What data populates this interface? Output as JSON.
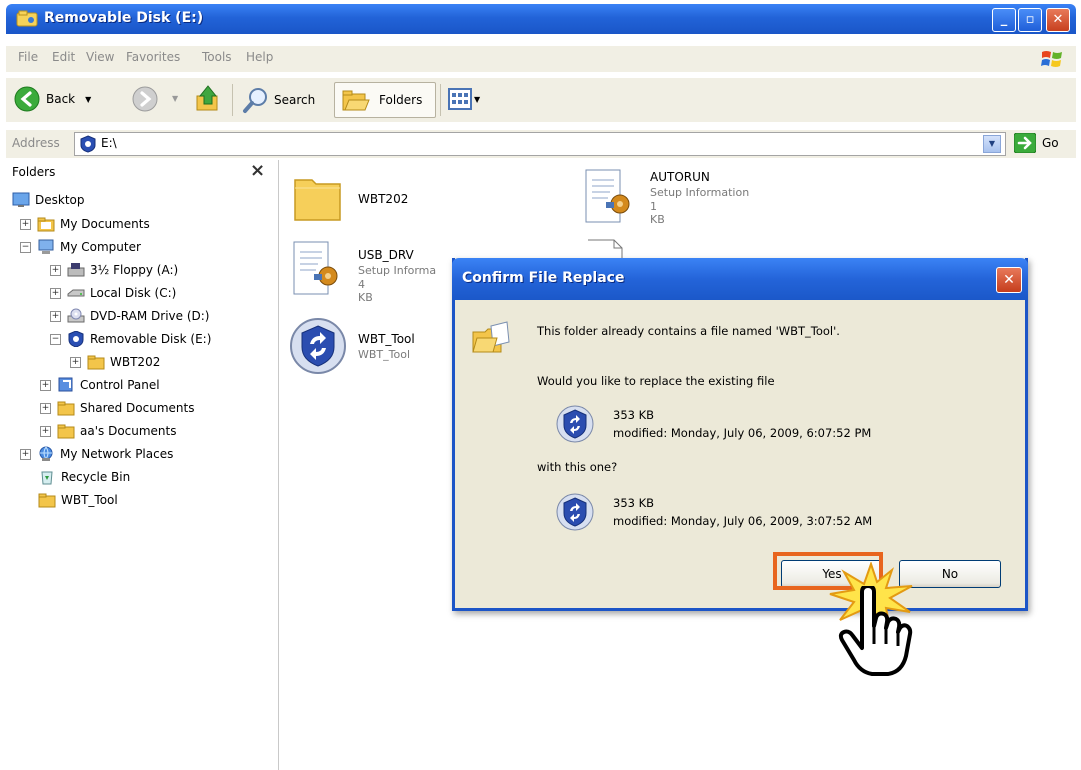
{
  "window": {
    "title": "Removable Disk (E:)",
    "buttons": [
      "minimize",
      "maximize",
      "close"
    ],
    "minimize_glyph": "_",
    "maximize_glyph": "▫",
    "close_glyph": "✕"
  },
  "menu": {
    "file": "File",
    "edit": "Edit",
    "view": "View",
    "favorites": "Favorites",
    "tools": "Tools",
    "help": "Help"
  },
  "toolbar": {
    "back": "Back",
    "search": "Search",
    "folders": "Folders"
  },
  "address": {
    "label": "Address",
    "value": "E:\\",
    "go": "Go"
  },
  "folder_pane": {
    "header": "Folders",
    "close_glyph": "×",
    "tree": [
      {
        "label": "Desktop",
        "expander": ""
      },
      {
        "label": "My Documents",
        "expander": "+"
      },
      {
        "label": "My Computer",
        "expander": "−"
      },
      {
        "label": "3½ Floppy (A:)",
        "expander": "+"
      },
      {
        "label": "Local Disk (C:)",
        "expander": "+"
      },
      {
        "label": "DVD-RAM Drive (D:)",
        "expander": "+"
      },
      {
        "label": "Removable Disk (E:)",
        "expander": "−"
      },
      {
        "label": "WBT202",
        "expander": "+"
      },
      {
        "label": "Control Panel",
        "expander": "+"
      },
      {
        "label": "Shared Documents",
        "expander": "+"
      },
      {
        "label": "aa's Documents",
        "expander": "+"
      },
      {
        "label": "My Network Places",
        "expander": "+"
      },
      {
        "label": "Recycle Bin",
        "expander": ""
      },
      {
        "label": "WBT_Tool",
        "expander": ""
      }
    ]
  },
  "files": [
    {
      "name": "WBT202",
      "type": "",
      "size": ""
    },
    {
      "name": "AUTORUN",
      "type": "Setup Information",
      "size": "1 KB"
    },
    {
      "name": "USB_DRV",
      "type": "Setup Informa",
      "size": "4 KB"
    },
    {
      "name": "WBT_Tool",
      "type": "WBT_Tool",
      "size": ""
    }
  ],
  "dialog": {
    "title": "Confirm File Replace",
    "close_glyph": "✕",
    "message": "This folder already contains a file named 'WBT_Tool'.",
    "question": "Would you like to replace the existing file",
    "existing": {
      "size": "353 KB",
      "modified": "modified: Monday, July 06, 2009, 6:07:52 PM"
    },
    "with_text": "with this one?",
    "new": {
      "size": "353 KB",
      "modified": "modified: Monday, July 06, 2009, 3:07:52 AM"
    },
    "yes": "Yes",
    "no": "No"
  },
  "colors": {
    "xp_blue": "#2263d8",
    "highlight_orange": "#e8651e",
    "dialog_bg": "#ece9d8"
  },
  "icons": [
    "folder-icon",
    "setup-file-icon",
    "wbt-tool-icon",
    "hand-cursor-icon",
    "click-burst-icon",
    "back-arrow-icon",
    "search-icon",
    "folders-icon",
    "views-icon",
    "go-arrow-icon",
    "windows-logo-icon"
  ]
}
